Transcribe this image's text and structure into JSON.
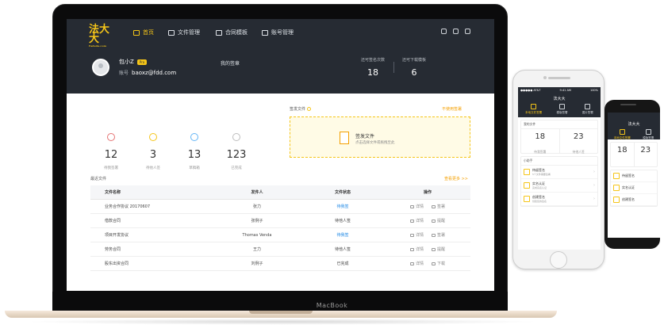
{
  "laptop": {
    "brand_label": "MacBook",
    "logo": {
      "text": "法大大",
      "sub": "Fadada.com"
    },
    "nav": [
      {
        "label": "首页",
        "icon": "home-icon",
        "active": true
      },
      {
        "label": "文件管理",
        "icon": "folder-icon",
        "active": false
      },
      {
        "label": "合同模板",
        "icon": "template-icon",
        "active": false
      },
      {
        "label": "账号管理",
        "icon": "user-icon",
        "active": false
      }
    ],
    "header_icons": [
      "cart-icon",
      "bell-icon",
      "logout-icon"
    ],
    "user": {
      "name": "包小Z",
      "badge": "Pro",
      "account_label": "账号",
      "account": "baoxz@fdd.com"
    },
    "my_signature_label": "我的签章",
    "quota": [
      {
        "label": "还可签名次数",
        "value": "18"
      },
      {
        "label": "还可下载模板",
        "value": "6"
      }
    ],
    "stats": [
      {
        "value": "12",
        "label": "待我签署",
        "icon": "pen-icon",
        "color": "#e57373"
      },
      {
        "value": "3",
        "label": "待他人签",
        "icon": "clock-icon",
        "color": "#f5c518"
      },
      {
        "value": "13",
        "label": "草稿箱",
        "icon": "layers-icon",
        "color": "#64b5f6"
      },
      {
        "value": "123",
        "label": "已完成",
        "icon": "check-doc-icon",
        "color": "#bdbdbd"
      }
    ],
    "sign": {
      "title": "签发文件",
      "link": "不使用签署",
      "upload_title": "签发文件",
      "upload_hint": "点击选择文件或拖拽至此"
    },
    "recent": {
      "title": "最近文件",
      "more": "查看更多 >>",
      "columns": [
        "文件名称",
        "发件人",
        "文件状态",
        "操作"
      ],
      "rows": [
        {
          "name": "业务合作协议 20170607",
          "sender": "张力",
          "status": "待我签",
          "blue": true,
          "actions": [
            "详情",
            "签署"
          ]
        },
        {
          "name": "借款合同",
          "sender": "张例子",
          "status": "待他人签",
          "blue": false,
          "actions": [
            "详情",
            "提醒"
          ]
        },
        {
          "name": "项目开发协议",
          "sender": "Thomas Venda",
          "status": "待我签",
          "blue": true,
          "actions": [
            "详情",
            "签署"
          ]
        },
        {
          "name": "劳务合同",
          "sender": "王力",
          "status": "待他人签",
          "blue": false,
          "actions": [
            "详情",
            "提醒"
          ]
        },
        {
          "name": "股东出资合同",
          "sender": "刘例子",
          "status": "已完成",
          "blue": false,
          "actions": [
            "详情",
            "下载"
          ]
        }
      ]
    }
  },
  "phone": {
    "status_left": "●●●●● AT&T",
    "status_time": "9:41 AM",
    "status_right": "100%",
    "title": "法大大",
    "tabs": [
      {
        "label": "本地文件签署",
        "active": true
      },
      {
        "label": "模版签署",
        "active": false
      },
      {
        "label": "图片签署",
        "active": false
      }
    ],
    "card_title": "我的文件",
    "card_more": "更多",
    "nums": [
      {
        "value": "18",
        "label": "待我签署"
      },
      {
        "value": "23",
        "label": "待他人签"
      }
    ],
    "list_title": "小助手",
    "list": [
      {
        "title": "待留签名",
        "sub": "5个文件需要签署",
        "icon": "sign-icon"
      },
      {
        "title": "实名认证",
        "sub": "完成实名认证",
        "icon": "id-icon"
      },
      {
        "title": "创建签名",
        "sub": "创建您的签名",
        "icon": "create-sign-icon"
      }
    ]
  },
  "phone2": {
    "title": "法大大",
    "tabs": [
      "本地文件签署",
      "模版签署"
    ],
    "nums": [
      "18",
      "23"
    ],
    "list": [
      "待留签名",
      "实名认证",
      "创建签名"
    ]
  }
}
